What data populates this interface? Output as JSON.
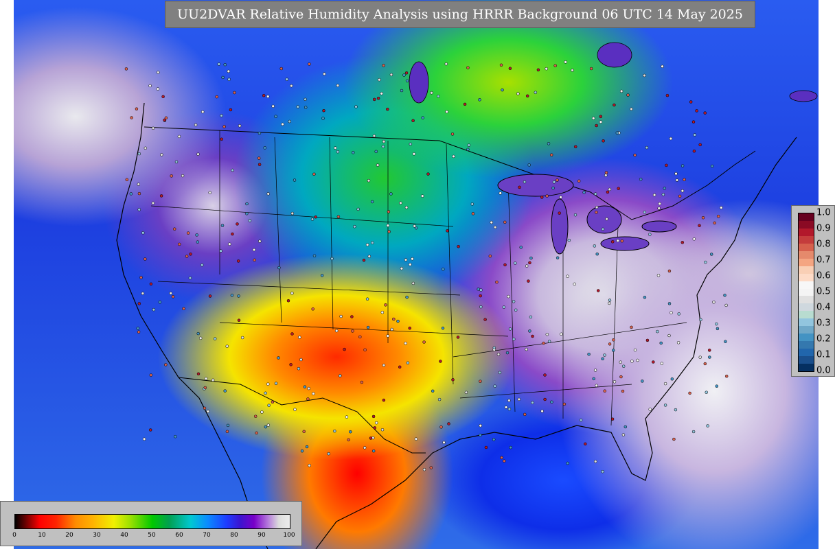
{
  "title": "UU2DVAR Relative Humidity Analysis using HRRR Background 06 UTC 14 May 2025",
  "rh_colorbar": {
    "ticks": [
      "0",
      "10",
      "20",
      "30",
      "40",
      "50",
      "60",
      "70",
      "80",
      "90",
      "100"
    ],
    "range": [
      0,
      100
    ]
  },
  "bias_colorbar": {
    "ticks": [
      "1.0",
      "0.9",
      "0.8",
      "0.7",
      "0.6",
      "0.5",
      "0.4",
      "0.3",
      "0.2",
      "0.1",
      "0.0"
    ],
    "colors": [
      "#67001f",
      "#8a0a24",
      "#b2182b",
      "#c43c3c",
      "#d6604d",
      "#e58a6c",
      "#f4a582",
      "#f9cfb5",
      "#fddbc7",
      "#f7f7f7",
      "#f4f4f4",
      "#e0e0e0",
      "#cfd8de",
      "#b8dcd0",
      "#92c5de",
      "#6fa8c8",
      "#4393c3",
      "#3478ae",
      "#2166ac",
      "#1a4f8c",
      "#053061"
    ]
  },
  "colors": {
    "ocean": "#1d3fe0",
    "frame": "#c0c0c0",
    "title_bg": "#808080",
    "borders": "#000000"
  }
}
